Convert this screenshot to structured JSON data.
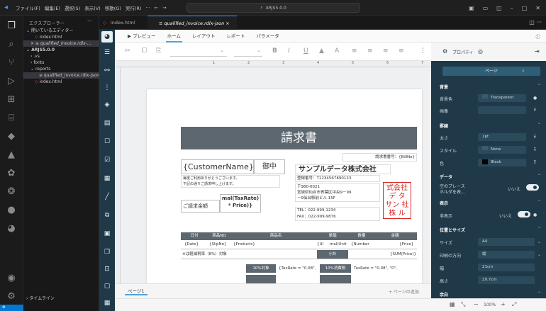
{
  "titlebar": {
    "menu": [
      "ファイル(F)",
      "編集(E)",
      "選択(S)",
      "表示(V)",
      "移動(G)",
      "実行(R)",
      "···",
      "←",
      "→"
    ],
    "search": "ARJS5.0.0"
  },
  "explorer": {
    "header": "エクスプローラー",
    "open_editors": "開いているエディター",
    "items": [
      "index.html",
      "× ≡ qualified_invoice.rdlx-...",
      "ARJS5.0.0",
      ".vs",
      "fonts",
      "reports",
      "≡ qualified_invoice.rdlx-json",
      "index.html"
    ],
    "timeline": "タイムライン"
  },
  "tabs": [
    {
      "label": "index.html"
    },
    {
      "label": "≡ qualified_invoice.rdlx-json ×"
    }
  ],
  "designer": {
    "preview": "▶ プレビュー",
    "tabs": [
      "ホーム",
      "レイアウト",
      "レポート",
      "パラメータ"
    ],
    "page_tab": "ページ1",
    "add_page": "+ ページの追加",
    "zoom": "100%",
    "ruler": [
      "1",
      "2",
      "3",
      "4",
      "5",
      "6",
      "7"
    ]
  },
  "properties": {
    "title": "プロパティ",
    "page_label": "ページ",
    "sections": {
      "bg": "背景",
      "border": "罫線",
      "data": "データ",
      "display": "表示",
      "pos": "位置とサイズ",
      "margin": "余白"
    },
    "labels": {
      "bgcolor": "背景色",
      "image": "画像",
      "width": "太さ",
      "style": "スタイル",
      "color": "色",
      "empty": "空のプレース",
      "empty2": "ホルダを表...",
      "hide": "非表示",
      "size": "サイズ",
      "orient": "印刷の方向",
      "w": "幅",
      "h": "高さ"
    },
    "values": {
      "bgcolor": "Transparent",
      "width": "1pt",
      "style": "None",
      "color": "Black",
      "empty": "いいえ",
      "hide": "いいえ",
      "size": "A4",
      "orient": "縦",
      "w": "21cm",
      "h": "29.7cm"
    }
  },
  "report": {
    "title": "請求書",
    "invoice_no": "請求書番号：{BillNo}",
    "customer": "{CustomerName}",
    "honorific": "御中",
    "company": "サンプルデータ株式会社",
    "reg": "登録番号：T1234567890123",
    "msg1": "毎度ご利用ありがとうございます。",
    "msg2": "下記の通りご請求申し上げます。",
    "zip": "〒980-0021",
    "addr1": "宮城県仙台市青葉区中央9－99",
    "addr2": "－9仙台駅前ビル 15F",
    "tel": "TEL：022-999-1234",
    "fax": "FAX：022-999-9876",
    "seal": "式会社 デ タ サン 社株 ル プ",
    "amount_label": "ご請求金額",
    "amount_value": "mal(TaxRate) * Price)}",
    "headers": [
      "日付",
      "商品NO",
      "商品名",
      "単価",
      "数量",
      "金額"
    ],
    "row": [
      "{Date}",
      "{SlipNo}",
      "{Products}",
      "{Ul",
      "mal(Unit",
      "{Number",
      "{Price}"
    ],
    "note": "※は軽減税率（8%）対象",
    "subtotal": "小計",
    "subtotal_v": "{SUM(Price)}",
    "tax10": "10%対象",
    "tax10v": "{TaxRate = \"0.08\",",
    "taxfee": "10%消費税",
    "taxfeev": "TaxRate = \"0.08\", \"0\","
  }
}
